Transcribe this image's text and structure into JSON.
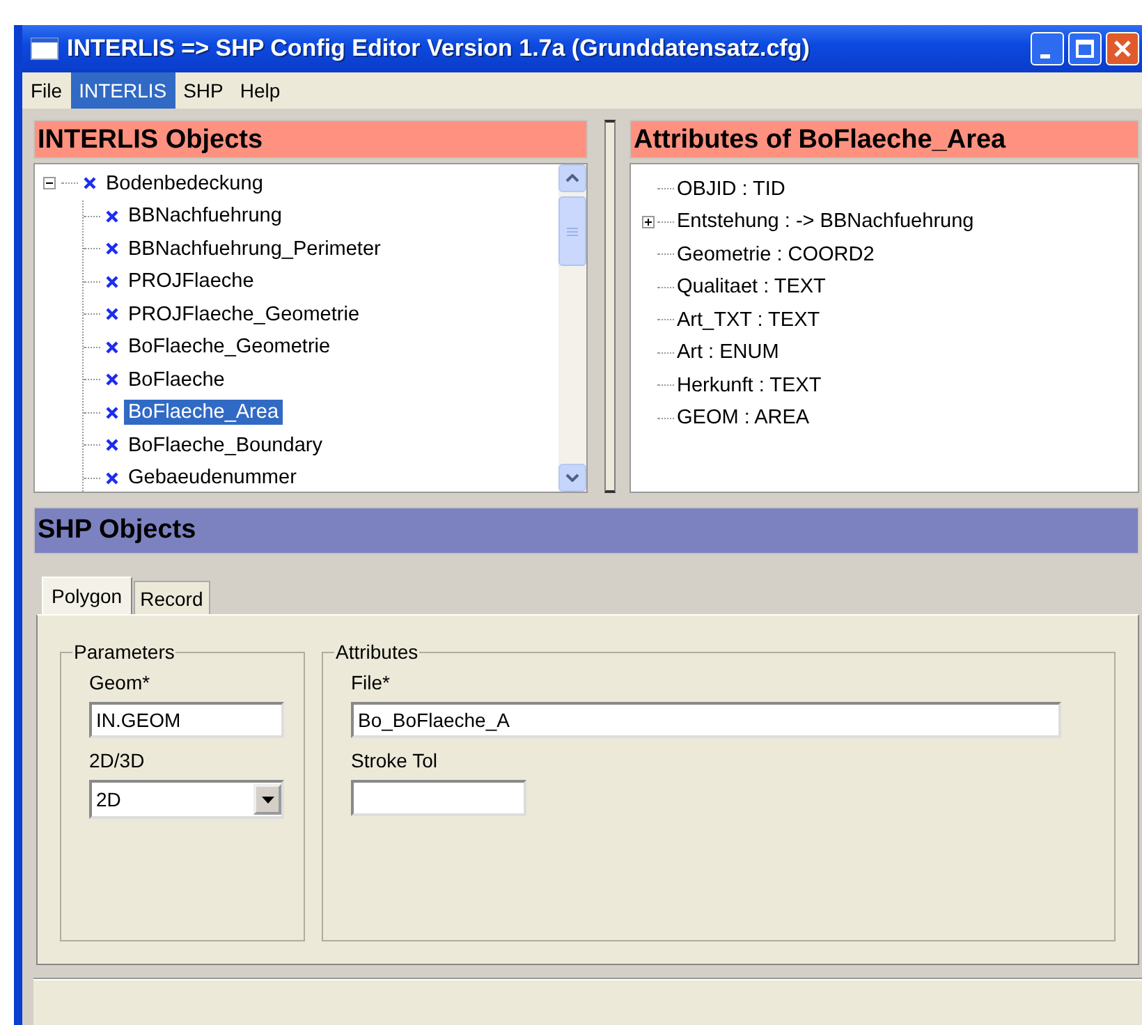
{
  "window": {
    "title": "INTERLIS => SHP Config Editor Version 1.7a (Grunddatensatz.cfg)"
  },
  "menu": [
    {
      "label": "File",
      "selected": false
    },
    {
      "label": "INTERLIS",
      "selected": true
    },
    {
      "label": "SHP",
      "selected": false
    },
    {
      "label": "Help",
      "selected": false
    }
  ],
  "interlis_objects": {
    "title": "INTERLIS Objects",
    "tree": [
      {
        "label": "Bodenbedeckung",
        "expanded": true,
        "selected": false,
        "children": [
          {
            "label": "BBNachfuehrung",
            "selected": false
          },
          {
            "label": "BBNachfuehrung_Perimeter",
            "selected": false
          },
          {
            "label": "PROJFlaeche",
            "selected": false
          },
          {
            "label": "PROJFlaeche_Geometrie",
            "selected": false
          },
          {
            "label": "BoFlaeche_Geometrie",
            "selected": false
          },
          {
            "label": "BoFlaeche",
            "selected": false
          },
          {
            "label": "BoFlaeche_Area",
            "selected": true
          },
          {
            "label": "BoFlaeche_Boundary",
            "selected": false
          },
          {
            "label": "Gebaeudenummer",
            "selected": false
          }
        ]
      }
    ]
  },
  "attributes": {
    "title": "Attributes of BoFlaeche_Area",
    "items": [
      {
        "label": "OBJID : TID",
        "collapsed": false
      },
      {
        "label": "Entstehung : -> BBNachfuehrung",
        "collapsed": true
      },
      {
        "label": "Geometrie : COORD2",
        "collapsed": false
      },
      {
        "label": "Qualitaet : TEXT",
        "collapsed": false
      },
      {
        "label": "Art_TXT : TEXT",
        "collapsed": false
      },
      {
        "label": "Art : ENUM",
        "collapsed": false
      },
      {
        "label": "Herkunft : TEXT",
        "collapsed": false
      },
      {
        "label": "GEOM : AREA",
        "collapsed": false
      }
    ]
  },
  "shp_objects": {
    "title": "SHP Objects",
    "tabs": [
      {
        "label": "Polygon",
        "selected": true
      },
      {
        "label": "Record",
        "selected": false
      }
    ],
    "parameters": {
      "title": "Parameters",
      "geom_label": "Geom*",
      "geom_value": "IN.GEOM",
      "dim_label": "2D/3D",
      "dim_value": "2D"
    },
    "attributes": {
      "title": "Attributes",
      "file_label": "File*",
      "file_value": "Bo_BoFlaeche_A",
      "stroke_label": "Stroke Tol"
    }
  }
}
